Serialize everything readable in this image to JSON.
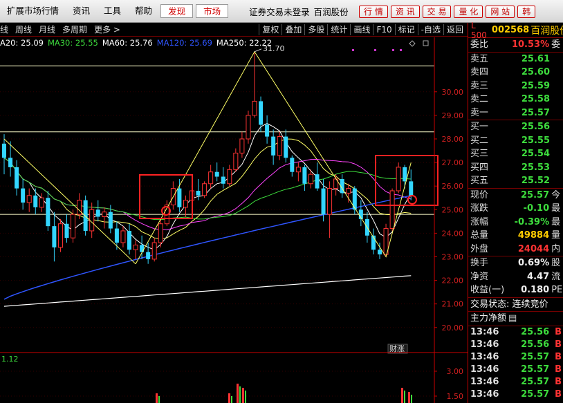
{
  "menu": {
    "items": [
      "扩展市场行情",
      "资讯",
      "工具",
      "帮助"
    ],
    "highlight_items": [
      "发现",
      "市场"
    ],
    "status": "证券交易未登录",
    "stock": "百润股份",
    "quick": [
      "行 情",
      "资 讯",
      "交 易",
      "量 化",
      "网 站",
      "韩"
    ]
  },
  "toolbar": {
    "periods": [
      "线",
      "周线",
      "月线",
      "多周期",
      "更多 >"
    ],
    "buttons": [
      "复权",
      "叠加",
      "多股",
      "统计",
      "画线",
      "F10",
      "标记",
      "-自选",
      "返回"
    ]
  },
  "ma_legend": [
    {
      "label": "A20: 25.09",
      "color": "#ffffff"
    },
    {
      "label": "MA30: 25.55",
      "color": "#3ddc3d"
    },
    {
      "label": "MA60: 25.76",
      "color": "#ffffff"
    },
    {
      "label": "MA120: 25.69",
      "color": "#2f55ff"
    },
    {
      "label": "MA250: 22.22",
      "color": "#ffffff"
    }
  ],
  "chart": {
    "y_ticks": [
      "30.00",
      "29.00",
      "28.00",
      "27.00",
      "26.00",
      "25.00",
      "24.00",
      "23.00",
      "22.00",
      "21.00",
      "20.00"
    ],
    "high_label": "31.70",
    "caizhang_label": "财涨",
    "sub_label": "1.12",
    "sub_ticks": [
      "3.00",
      "1.50"
    ]
  },
  "panel": {
    "market": "L 500",
    "code": "002568",
    "name": "百润股份",
    "weibi": {
      "label": "委比",
      "value": "10.53%",
      "ext": "委"
    },
    "sell": [
      {
        "label": "卖五",
        "price": "25.61"
      },
      {
        "label": "卖四",
        "price": "25.60"
      },
      {
        "label": "卖三",
        "price": "25.59"
      },
      {
        "label": "卖二",
        "price": "25.58"
      },
      {
        "label": "卖一",
        "price": "25.57"
      }
    ],
    "buy": [
      {
        "label": "买一",
        "price": "25.56"
      },
      {
        "label": "买二",
        "price": "25.55"
      },
      {
        "label": "买三",
        "price": "25.54"
      },
      {
        "label": "买四",
        "price": "25.53"
      },
      {
        "label": "买五",
        "price": "25.52"
      }
    ],
    "quote": [
      {
        "label": "现价",
        "value": "25.57",
        "ext": "今",
        "color": "green"
      },
      {
        "label": "涨跌",
        "value": "-0.10",
        "ext": "最",
        "color": "green"
      },
      {
        "label": "涨幅",
        "value": "-0.39%",
        "ext": "最",
        "color": "green"
      },
      {
        "label": "总量",
        "value": "49884",
        "ext": "量",
        "color": "yellow"
      },
      {
        "label": "外盘",
        "value": "24044",
        "ext": "内",
        "color": "red"
      }
    ],
    "fund": [
      {
        "label": "换手",
        "value": "0.69%",
        "ext": "股"
      },
      {
        "label": "净资",
        "value": "4.47",
        "ext": "流"
      },
      {
        "label": "收益(一)",
        "value": "0.180",
        "ext": "PE"
      }
    ],
    "trade_status": "交易状态: 连续竞价",
    "main_flow": "主力净额",
    "ticks": [
      {
        "time": "13:46",
        "price": "25.56",
        "mark": "B"
      },
      {
        "time": "13:46",
        "price": "25.56",
        "mark": "B"
      },
      {
        "time": "13:46",
        "price": "25.57",
        "mark": "B"
      },
      {
        "time": "13:46",
        "price": "25.57",
        "mark": "B"
      },
      {
        "time": "13:46",
        "price": "25.57",
        "mark": "B"
      },
      {
        "time": "13:46",
        "price": "25.57",
        "mark": "B"
      }
    ]
  },
  "chart_data": {
    "type": "candlestick",
    "ylim": [
      19.7,
      31.9
    ],
    "candles": [
      [
        27.8,
        28.2,
        26.5,
        27.2
      ],
      [
        27.2,
        27.9,
        26.4,
        26.8
      ],
      [
        26.8,
        27.1,
        25.6,
        25.9
      ],
      [
        25.9,
        26.3,
        25.0,
        25.3
      ],
      [
        25.3,
        25.9,
        24.9,
        25.6
      ],
      [
        25.6,
        25.9,
        24.8,
        25.1
      ],
      [
        25.1,
        25.7,
        24.9,
        25.5
      ],
      [
        25.5,
        25.8,
        24.1,
        24.3
      ],
      [
        24.3,
        24.9,
        22.8,
        23.4
      ],
      [
        23.4,
        24.6,
        23.2,
        24.4
      ],
      [
        24.4,
        24.8,
        23.6,
        23.8
      ],
      [
        23.8,
        25.0,
        23.6,
        24.8
      ],
      [
        24.8,
        25.7,
        24.6,
        25.4
      ],
      [
        25.4,
        25.6,
        23.9,
        24.1
      ],
      [
        24.1,
        25.3,
        23.8,
        25.0
      ],
      [
        25.0,
        25.4,
        24.5,
        24.7
      ],
      [
        24.7,
        25.1,
        24.2,
        24.9
      ],
      [
        24.9,
        25.2,
        24.0,
        24.2
      ],
      [
        24.2,
        24.5,
        23.3,
        23.6
      ],
      [
        23.6,
        24.3,
        23.4,
        24.1
      ],
      [
        24.1,
        24.4,
        23.1,
        23.3
      ],
      [
        23.3,
        23.7,
        22.9,
        23.5
      ],
      [
        23.5,
        23.9,
        22.9,
        23.2
      ],
      [
        23.2,
        23.6,
        22.7,
        22.9
      ],
      [
        22.9,
        23.8,
        22.8,
        23.6
      ],
      [
        23.6,
        24.6,
        23.4,
        24.4
      ],
      [
        24.4,
        25.4,
        24.3,
        25.2
      ],
      [
        25.2,
        26.2,
        25.0,
        25.9
      ],
      [
        25.9,
        26.3,
        24.9,
        25.1
      ],
      [
        25.1,
        25.6,
        24.7,
        25.4
      ],
      [
        25.4,
        26.0,
        25.2,
        25.8
      ],
      [
        25.8,
        26.3,
        25.4,
        25.6
      ],
      [
        25.6,
        26.2,
        25.5,
        26.1
      ],
      [
        26.1,
        26.9,
        25.9,
        26.6
      ],
      [
        26.6,
        27.0,
        26.2,
        26.4
      ],
      [
        26.4,
        26.8,
        25.9,
        26.1
      ],
      [
        26.1,
        26.9,
        26.0,
        26.7
      ],
      [
        26.7,
        27.6,
        26.6,
        27.4
      ],
      [
        27.4,
        28.3,
        27.2,
        28.0
      ],
      [
        28.0,
        29.2,
        27.8,
        29.0
      ],
      [
        29.0,
        31.7,
        28.9,
        29.6
      ],
      [
        29.6,
        29.8,
        28.3,
        28.6
      ],
      [
        28.6,
        29.0,
        27.8,
        28.1
      ],
      [
        28.1,
        28.4,
        26.9,
        27.3
      ],
      [
        27.3,
        28.3,
        27.1,
        28.1
      ],
      [
        28.1,
        28.4,
        27.0,
        27.2
      ],
      [
        27.2,
        27.3,
        26.4,
        26.6
      ],
      [
        26.6,
        27.0,
        26.2,
        26.8
      ],
      [
        26.8,
        26.9,
        25.8,
        26.1
      ],
      [
        26.1,
        26.7,
        25.9,
        26.5
      ],
      [
        26.5,
        27.0,
        25.8,
        25.9
      ],
      [
        25.9,
        26.3,
        24.5,
        24.8
      ],
      [
        24.8,
        26.2,
        23.8,
        25.9
      ],
      [
        25.9,
        26.5,
        25.6,
        26.3
      ],
      [
        26.3,
        26.5,
        25.5,
        25.7
      ],
      [
        25.7,
        26.1,
        25.3,
        25.9
      ],
      [
        25.9,
        26.0,
        24.8,
        25.0
      ],
      [
        25.0,
        25.4,
        24.3,
        24.6
      ],
      [
        24.6,
        24.9,
        23.6,
        23.9
      ],
      [
        23.9,
        24.2,
        23.1,
        23.3
      ],
      [
        23.3,
        23.6,
        22.9,
        23.1
      ],
      [
        23.1,
        24.4,
        23.0,
        24.2
      ],
      [
        24.2,
        25.9,
        24.1,
        25.8
      ],
      [
        25.8,
        27.0,
        25.7,
        26.8
      ],
      [
        26.8,
        26.9,
        25.9,
        26.2
      ],
      [
        26.2,
        26.7,
        25.4,
        25.57
      ]
    ],
    "high_mark": 31.7,
    "hlines": [
      31.1,
      28.3,
      24.8
    ]
  }
}
